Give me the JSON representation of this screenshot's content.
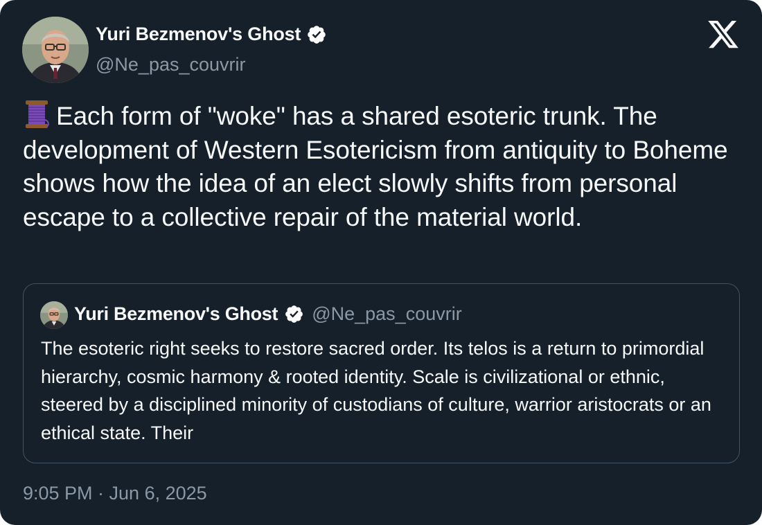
{
  "tweet": {
    "author": {
      "display_name": "Yuri Bezmenov's Ghost",
      "handle": "@Ne_pas_couvrir",
      "verified": true
    },
    "text": "Each form of \"woke\" has a shared esoteric trunk. The development of Western Esotericism from antiquity to Boheme shows how the idea of an elect slowly shifts from personal escape to a collective repair of the material world.",
    "leading_emoji": "spool-of-thread-icon",
    "timestamp": "9:05 PM · Jun 6, 2025"
  },
  "quoted_tweet": {
    "author": {
      "display_name": "Yuri Bezmenov's Ghost",
      "handle": "@Ne_pas_couvrir",
      "verified": true
    },
    "text": "The esoteric right seeks to restore sacred order. Its telos is a return to primordial hierarchy, cosmic harmony & rooted identity. Scale is civilizational or ethnic, steered by a disciplined minority of custodians of culture, warrior aristocrats or an ethical state. Their"
  },
  "brand": {
    "logo": "x-logo-icon"
  },
  "colors": {
    "background": "#15202b",
    "primary_text": "#f7f9f9",
    "secondary_text": "#8b98a5",
    "border": "#425364",
    "verified_badge": "#ffffff"
  }
}
